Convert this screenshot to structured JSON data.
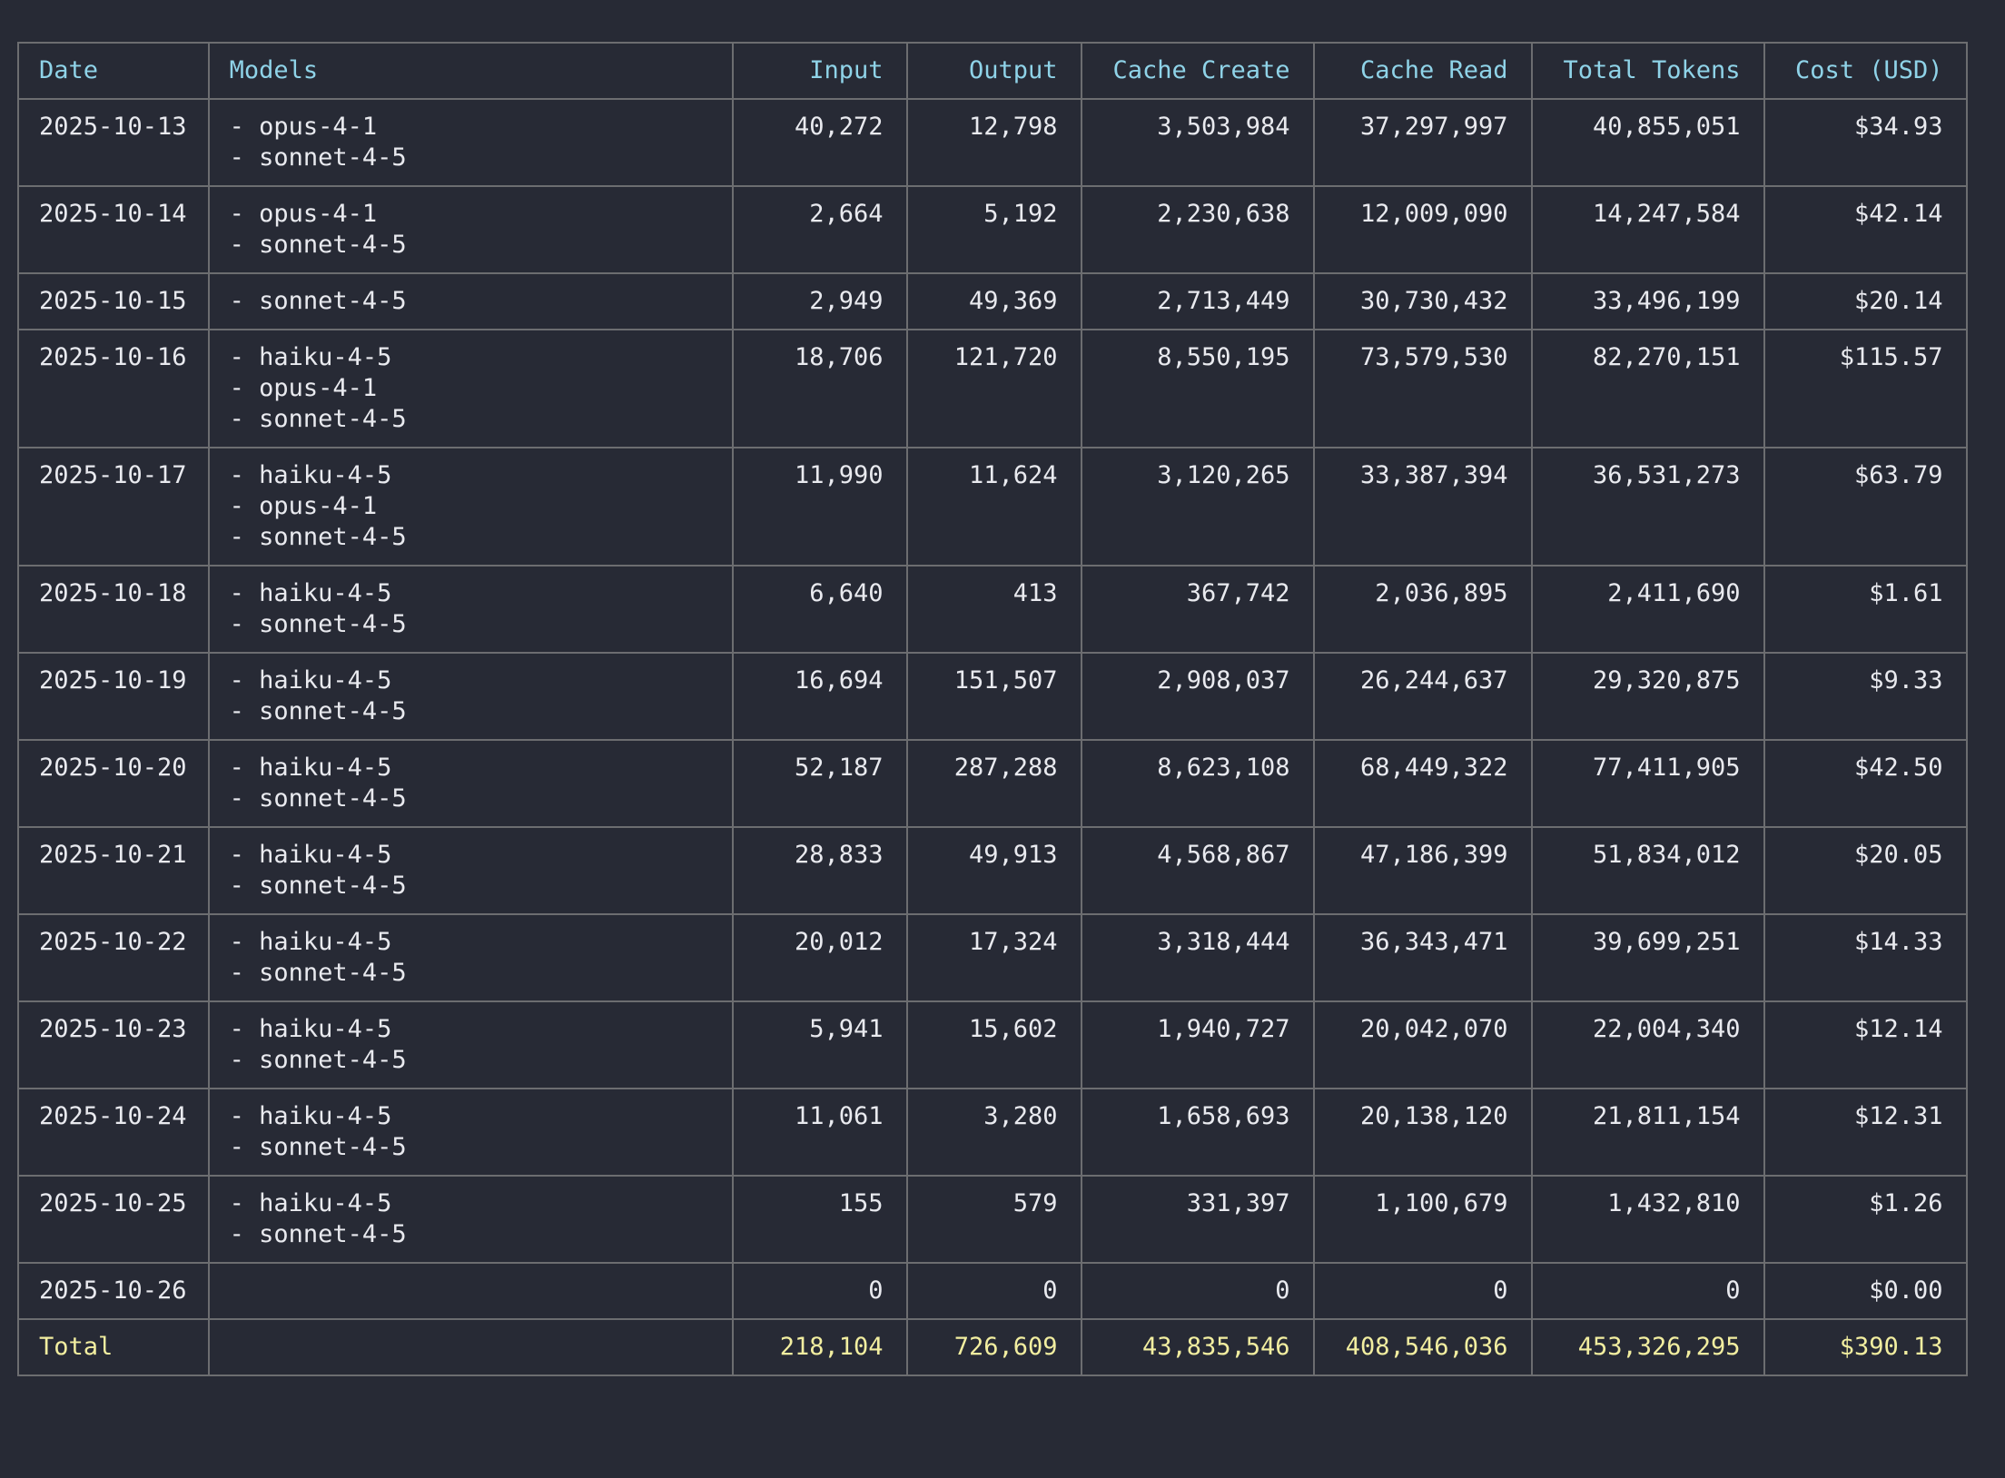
{
  "columns": [
    "Date",
    "Models",
    "Input",
    "Output",
    "Cache Create",
    "Cache Read",
    "Total Tokens",
    "Cost (USD)"
  ],
  "rows": [
    {
      "date": "2025-10-13",
      "models": [
        "- opus-4-1",
        "- sonnet-4-5"
      ],
      "input": "40,272",
      "output": "12,798",
      "cache_create": "3,503,984",
      "cache_read": "37,297,997",
      "total_tokens": "40,855,051",
      "cost": "$34.93"
    },
    {
      "date": "2025-10-14",
      "models": [
        "- opus-4-1",
        "- sonnet-4-5"
      ],
      "input": "2,664",
      "output": "5,192",
      "cache_create": "2,230,638",
      "cache_read": "12,009,090",
      "total_tokens": "14,247,584",
      "cost": "$42.14"
    },
    {
      "date": "2025-10-15",
      "models": [
        "- sonnet-4-5"
      ],
      "input": "2,949",
      "output": "49,369",
      "cache_create": "2,713,449",
      "cache_read": "30,730,432",
      "total_tokens": "33,496,199",
      "cost": "$20.14"
    },
    {
      "date": "2025-10-16",
      "models": [
        "- haiku-4-5",
        "- opus-4-1",
        "- sonnet-4-5"
      ],
      "input": "18,706",
      "output": "121,720",
      "cache_create": "8,550,195",
      "cache_read": "73,579,530",
      "total_tokens": "82,270,151",
      "cost": "$115.57"
    },
    {
      "date": "2025-10-17",
      "models": [
        "- haiku-4-5",
        "- opus-4-1",
        "- sonnet-4-5"
      ],
      "input": "11,990",
      "output": "11,624",
      "cache_create": "3,120,265",
      "cache_read": "33,387,394",
      "total_tokens": "36,531,273",
      "cost": "$63.79"
    },
    {
      "date": "2025-10-18",
      "models": [
        "- haiku-4-5",
        "- sonnet-4-5"
      ],
      "input": "6,640",
      "output": "413",
      "cache_create": "367,742",
      "cache_read": "2,036,895",
      "total_tokens": "2,411,690",
      "cost": "$1.61"
    },
    {
      "date": "2025-10-19",
      "models": [
        "- haiku-4-5",
        "- sonnet-4-5"
      ],
      "input": "16,694",
      "output": "151,507",
      "cache_create": "2,908,037",
      "cache_read": "26,244,637",
      "total_tokens": "29,320,875",
      "cost": "$9.33"
    },
    {
      "date": "2025-10-20",
      "models": [
        "- haiku-4-5",
        "- sonnet-4-5"
      ],
      "input": "52,187",
      "output": "287,288",
      "cache_create": "8,623,108",
      "cache_read": "68,449,322",
      "total_tokens": "77,411,905",
      "cost": "$42.50"
    },
    {
      "date": "2025-10-21",
      "models": [
        "- haiku-4-5",
        "- sonnet-4-5"
      ],
      "input": "28,833",
      "output": "49,913",
      "cache_create": "4,568,867",
      "cache_read": "47,186,399",
      "total_tokens": "51,834,012",
      "cost": "$20.05"
    },
    {
      "date": "2025-10-22",
      "models": [
        "- haiku-4-5",
        "- sonnet-4-5"
      ],
      "input": "20,012",
      "output": "17,324",
      "cache_create": "3,318,444",
      "cache_read": "36,343,471",
      "total_tokens": "39,699,251",
      "cost": "$14.33"
    },
    {
      "date": "2025-10-23",
      "models": [
        "- haiku-4-5",
        "- sonnet-4-5"
      ],
      "input": "5,941",
      "output": "15,602",
      "cache_create": "1,940,727",
      "cache_read": "20,042,070",
      "total_tokens": "22,004,340",
      "cost": "$12.14"
    },
    {
      "date": "2025-10-24",
      "models": [
        "- haiku-4-5",
        "- sonnet-4-5"
      ],
      "input": "11,061",
      "output": "3,280",
      "cache_create": "1,658,693",
      "cache_read": "20,138,120",
      "total_tokens": "21,811,154",
      "cost": "$12.31"
    },
    {
      "date": "2025-10-25",
      "models": [
        "- haiku-4-5",
        "- sonnet-4-5"
      ],
      "input": "155",
      "output": "579",
      "cache_create": "331,397",
      "cache_read": "1,100,679",
      "total_tokens": "1,432,810",
      "cost": "$1.26"
    },
    {
      "date": "2025-10-26",
      "models": [],
      "input": "0",
      "output": "0",
      "cache_create": "0",
      "cache_read": "0",
      "total_tokens": "0",
      "cost": "$0.00"
    }
  ],
  "total": {
    "label": "Total",
    "models": "",
    "input": "218,104",
    "output": "726,609",
    "cache_create": "43,835,546",
    "cache_read": "408,546,036",
    "total_tokens": "453,326,295",
    "cost": "$390.13"
  },
  "colors": {
    "background": "#272a35",
    "border": "#6c6d70",
    "text": "#e9eaef",
    "header_text": "#8fd3e8",
    "total_text": "#f2eea0"
  }
}
